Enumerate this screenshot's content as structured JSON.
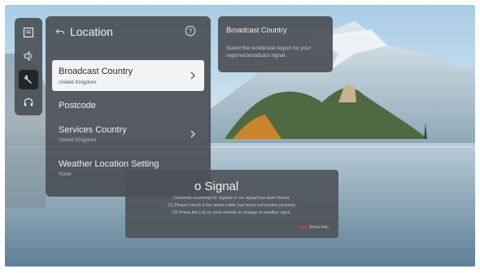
{
  "rail": {
    "icons": [
      "picture-icon",
      "sound-icon",
      "general-wrench-icon",
      "support-headset-icon"
    ],
    "active_index": 2
  },
  "panel": {
    "title": "Location",
    "items": [
      {
        "label": "Broadcast Country",
        "value": "United Kingdom",
        "has_arrow": true,
        "selected": true
      },
      {
        "label": "Postcode",
        "value": "",
        "has_arrow": false,
        "selected": false
      },
      {
        "label": "Services Country",
        "value": "United Kingdom",
        "has_arrow": true,
        "selected": false
      },
      {
        "label": "Weather Location Setting",
        "value": "None",
        "has_arrow": false,
        "selected": false
      }
    ]
  },
  "tooltip": {
    "title": "Broadcast Country",
    "text": "Select the residential region for your regional broadcast signal."
  },
  "no_signal": {
    "title": "o Signal",
    "line1": "Currently scanning for signals or no signal has been found.",
    "line2": "(1) Please check if the aerial cable has been connected properly.",
    "line3": "(2) Press the [⇥] on your remote to change to another input.",
    "show_info": "Show Info"
  },
  "colors": {
    "accent_red": "#e0393e",
    "panel_bg": "#484c52",
    "selected_bg": "#f3f3f3"
  }
}
